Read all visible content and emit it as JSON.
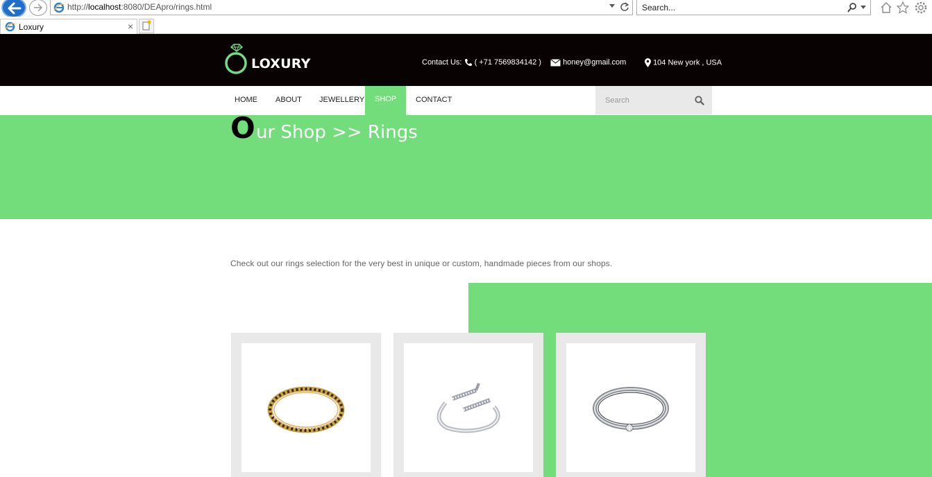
{
  "browser": {
    "url_prefix": "http://",
    "url_host": "localhost",
    "url_rest": ":8080/DEApro/rings.html",
    "search_placeholder": "Search...",
    "tab_title": "Loxury",
    "tab_close": "×"
  },
  "header": {
    "brand": "LOXURY",
    "contact_label": "Contact Us:",
    "phone": "( +71 7569834142 )",
    "email": "honey@gmail.com",
    "address": "104 New york , USA"
  },
  "nav": {
    "items": [
      {
        "label": "HOME"
      },
      {
        "label": "ABOUT"
      },
      {
        "label": "JEWELLERY"
      },
      {
        "label": "SHOP"
      },
      {
        "label": "CONTACT"
      }
    ],
    "active": "SHOP",
    "search_placeholder": "Search"
  },
  "banner": {
    "drop_letter": "O",
    "title_rest": "ur Shop >> Rings"
  },
  "intro": "Check out our rings selection for the very best in unique or custom, handmade pieces from our shops.",
  "products": [
    {
      "image": "gold-diamond-band-ring"
    },
    {
      "image": "silver-open-bypass-ring"
    },
    {
      "image": "silver-solitaire-ring"
    }
  ],
  "colors": {
    "accent": "#72dd7a",
    "header_bg": "#080202",
    "card_bg": "#e9e9e9"
  }
}
